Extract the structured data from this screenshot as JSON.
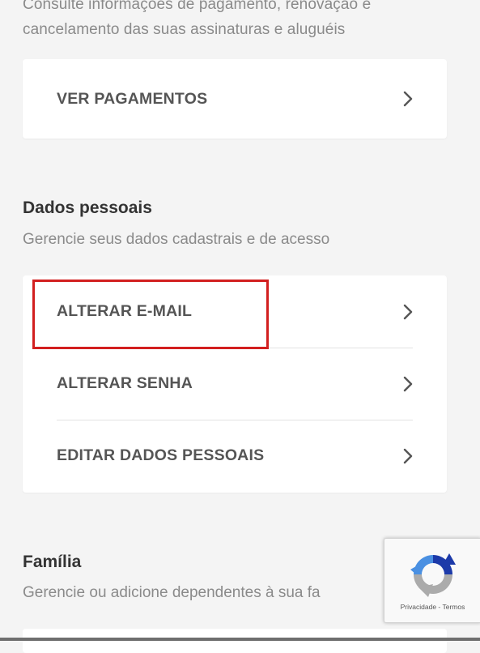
{
  "payments": {
    "description": "Consulte informações de pagamento, renovação e cancelamento das suas assinaturas e aluguéis",
    "button_label": "VER PAGAMENTOS"
  },
  "personal": {
    "title": "Dados pessoais",
    "subtitle": "Gerencie seus dados cadastrais e de acesso",
    "items": [
      {
        "label": "ALTERAR E-MAIL"
      },
      {
        "label": "ALTERAR SENHA"
      },
      {
        "label": "EDITAR DADOS PESSOAIS"
      }
    ]
  },
  "family": {
    "title": "Família",
    "subtitle": "Gerencie ou adicione dependentes à sua fa"
  },
  "recaptcha": {
    "privacy_label": "Privacidade",
    "separator": " - ",
    "terms_label": "Termos"
  },
  "colors": {
    "highlight": "#d21f1f",
    "background": "#f4f4f4",
    "card": "#ffffff",
    "recaptcha_blue": "#1c3aa9",
    "recaptcha_lightblue": "#4a90e2",
    "recaptcha_gray": "#ababab"
  },
  "icons": {
    "row_chevron": "chevron-right-icon",
    "captcha": "recaptcha-logo-icon"
  }
}
